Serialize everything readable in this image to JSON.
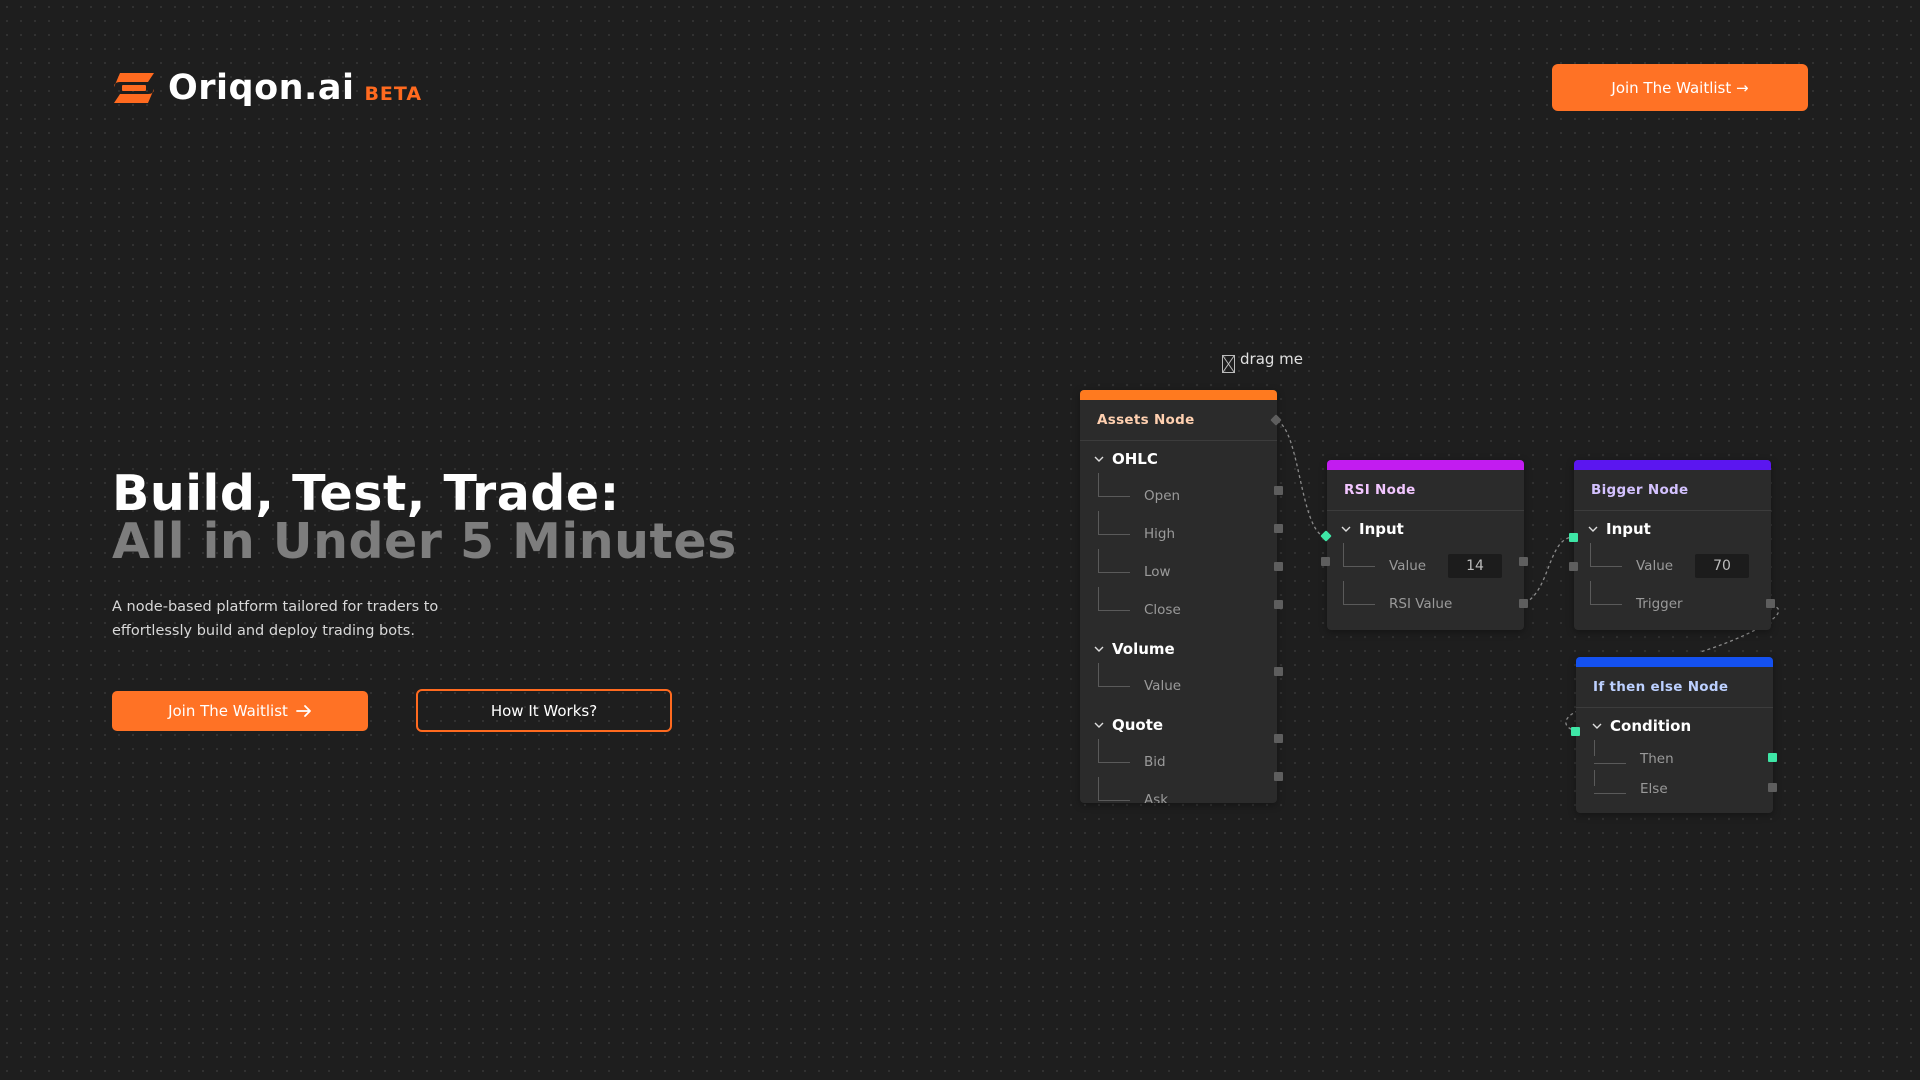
{
  "brand": {
    "name": "Oriqon.ai",
    "badge": "BETA",
    "accent": "#ff6a1f"
  },
  "header": {
    "cta_label": "Join The Waitlist →"
  },
  "hero": {
    "title_line1": "Build, Test, Trade:",
    "title_line2": "All in Under 5 Minutes",
    "description": "A node-based platform tailored for traders to effortlessly build and deploy trading bots.",
    "primary_cta": "Join The Waitlist",
    "secondary_cta": "How It Works?"
  },
  "drag_hint": "drag me",
  "nodes": {
    "assets": {
      "title": "Assets Node",
      "color": "#ff7a1f",
      "ohlc_label": "OHLC",
      "open": "Open",
      "high": "High",
      "low": "Low",
      "close": "Close",
      "volume_label": "Volume",
      "volume_value": "Value",
      "quote_label": "Quote",
      "bid": "Bid",
      "ask": "Ask"
    },
    "rsi": {
      "title": "RSI Node",
      "color": "#c21cf0",
      "input_label": "Input",
      "value_label": "Value",
      "value": "14",
      "output_label": "RSI Value"
    },
    "bigger": {
      "title": "Bigger Node",
      "color": "#5b16f0",
      "input_label": "Input",
      "value_label": "Value",
      "value": "70",
      "output_label": "Trigger"
    },
    "ifelse": {
      "title": "If then else Node",
      "color": "#1451f0",
      "condition_label": "Condition",
      "then_label": "Then",
      "else_label": "Else"
    }
  }
}
